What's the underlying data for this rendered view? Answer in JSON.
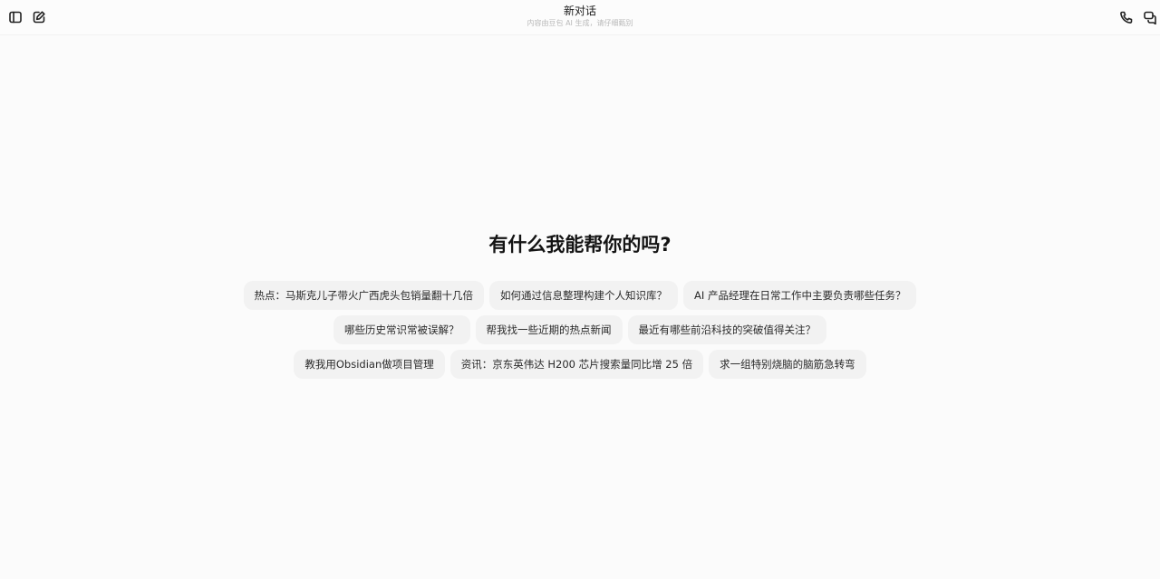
{
  "header": {
    "title": "新对话",
    "subtitle": "内容由豆包 AI 生成，请仔细甄别",
    "icons": [
      "sidebar-toggle-icon",
      "new-chat-icon",
      "phone-icon",
      "chat-bubbles-icon"
    ]
  },
  "main": {
    "heading": "有什么我能帮你的吗?",
    "suggestions_row1": [
      "热点：马斯克儿子带火广西虎头包销量翻十几倍",
      "如何通过信息整理构建个人知识库？",
      "AI 产品经理在日常工作中主要负责哪些任务？"
    ],
    "suggestions_row2": [
      "哪些历史常识常被误解？",
      "帮我找一些近期的热点新闻",
      "最近有哪些前沿科技的突破值得关注？"
    ],
    "suggestions_row3": [
      "教我用Obsidian做项目管理",
      "资讯：京东英伟达 H200 芯片搜索量同比增 25 倍",
      "求一组特别烧脑的脑筋急转弯"
    ]
  }
}
